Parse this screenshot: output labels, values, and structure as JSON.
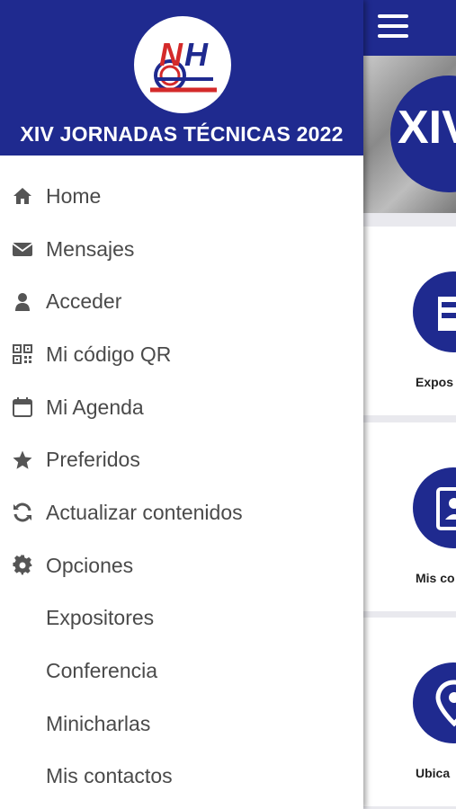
{
  "app": {
    "title": "XIV JORNADAS TÉCNICAS 2022",
    "logo_text": "NH",
    "banner_text": "XIV",
    "accent_color": "#1f2a8f"
  },
  "menu": {
    "items": [
      {
        "label": "Home",
        "icon": "home-icon"
      },
      {
        "label": "Mensajes",
        "icon": "envelope-icon"
      },
      {
        "label": "Acceder",
        "icon": "user-icon"
      },
      {
        "label": "Mi código QR",
        "icon": "qr-code-icon"
      },
      {
        "label": "Mi Agenda",
        "icon": "calendar-icon"
      },
      {
        "label": "Preferidos",
        "icon": "star-icon"
      },
      {
        "label": "Actualizar contenidos",
        "icon": "refresh-icon"
      },
      {
        "label": "Opciones",
        "icon": "gear-icon"
      },
      {
        "label": "Expositores",
        "icon": ""
      },
      {
        "label": "Conferencia",
        "icon": ""
      },
      {
        "label": "Minicharlas",
        "icon": ""
      },
      {
        "label": "Mis contactos",
        "icon": ""
      }
    ]
  },
  "background": {
    "tiles": [
      {
        "label": "Expos",
        "icon": "exhibitor-icon"
      },
      {
        "label": "Mis co",
        "icon": "contacts-icon"
      },
      {
        "label": "Ubica",
        "icon": "location-icon"
      }
    ]
  }
}
